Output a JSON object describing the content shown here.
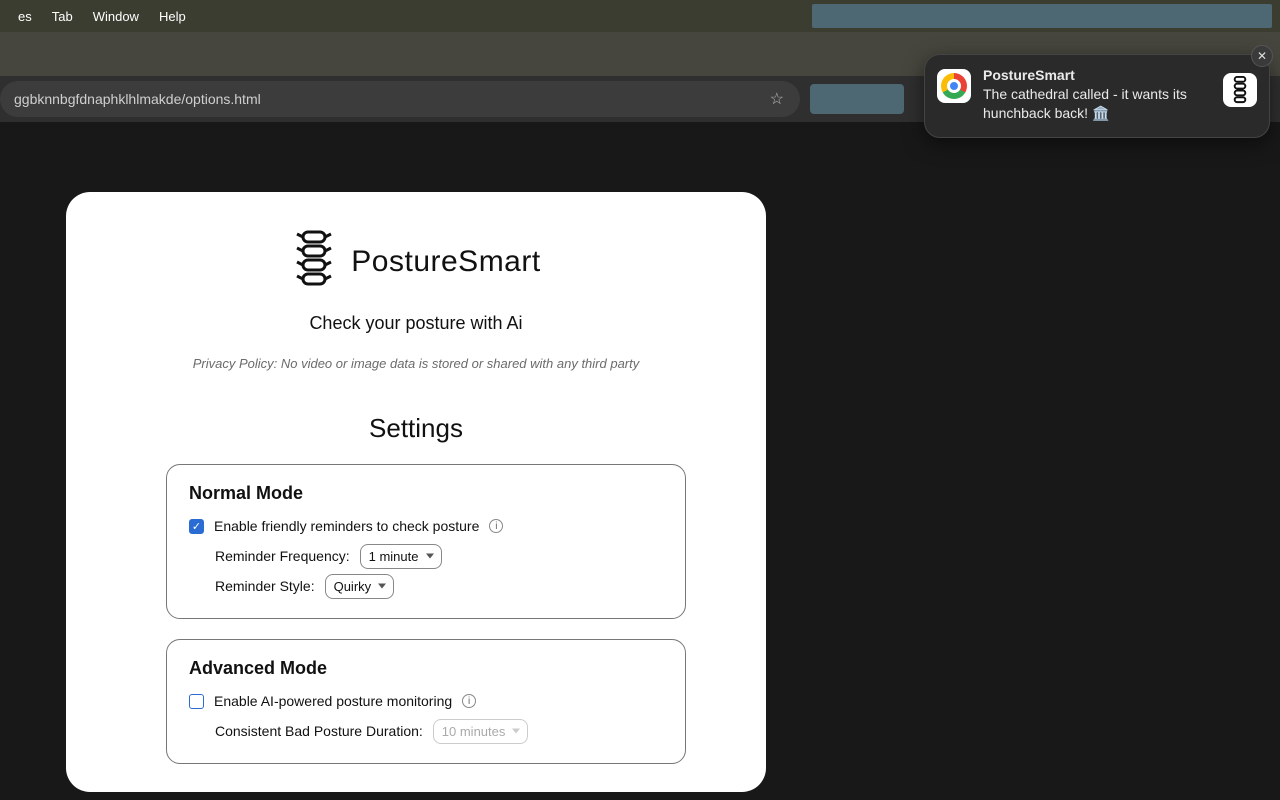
{
  "menubar": {
    "items": [
      "es",
      "Tab",
      "Window",
      "Help"
    ]
  },
  "browser": {
    "url_fragment": "ggbknnbgfdnaphklhlmakde/options.html"
  },
  "page": {
    "app_name": "PostureSmart",
    "tagline": "Check your posture with Ai",
    "privacy": "Privacy Policy: No video or image data is stored or shared with any third party",
    "settings_heading": "Settings",
    "normal": {
      "title": "Normal Mode",
      "enable_label": "Enable friendly reminders to check posture",
      "enable_checked": true,
      "freq_label": "Reminder Frequency:",
      "freq_value": "1 minute",
      "style_label": "Reminder Style:",
      "style_value": "Quirky"
    },
    "advanced": {
      "title": "Advanced Mode",
      "enable_label": "Enable AI-powered posture monitoring",
      "enable_checked": false,
      "duration_label": "Consistent Bad Posture Duration:",
      "duration_value": "10 minutes"
    }
  },
  "toast": {
    "title": "PostureSmart",
    "body": "The cathedral called - it wants its hunchback back! 🏛️"
  }
}
